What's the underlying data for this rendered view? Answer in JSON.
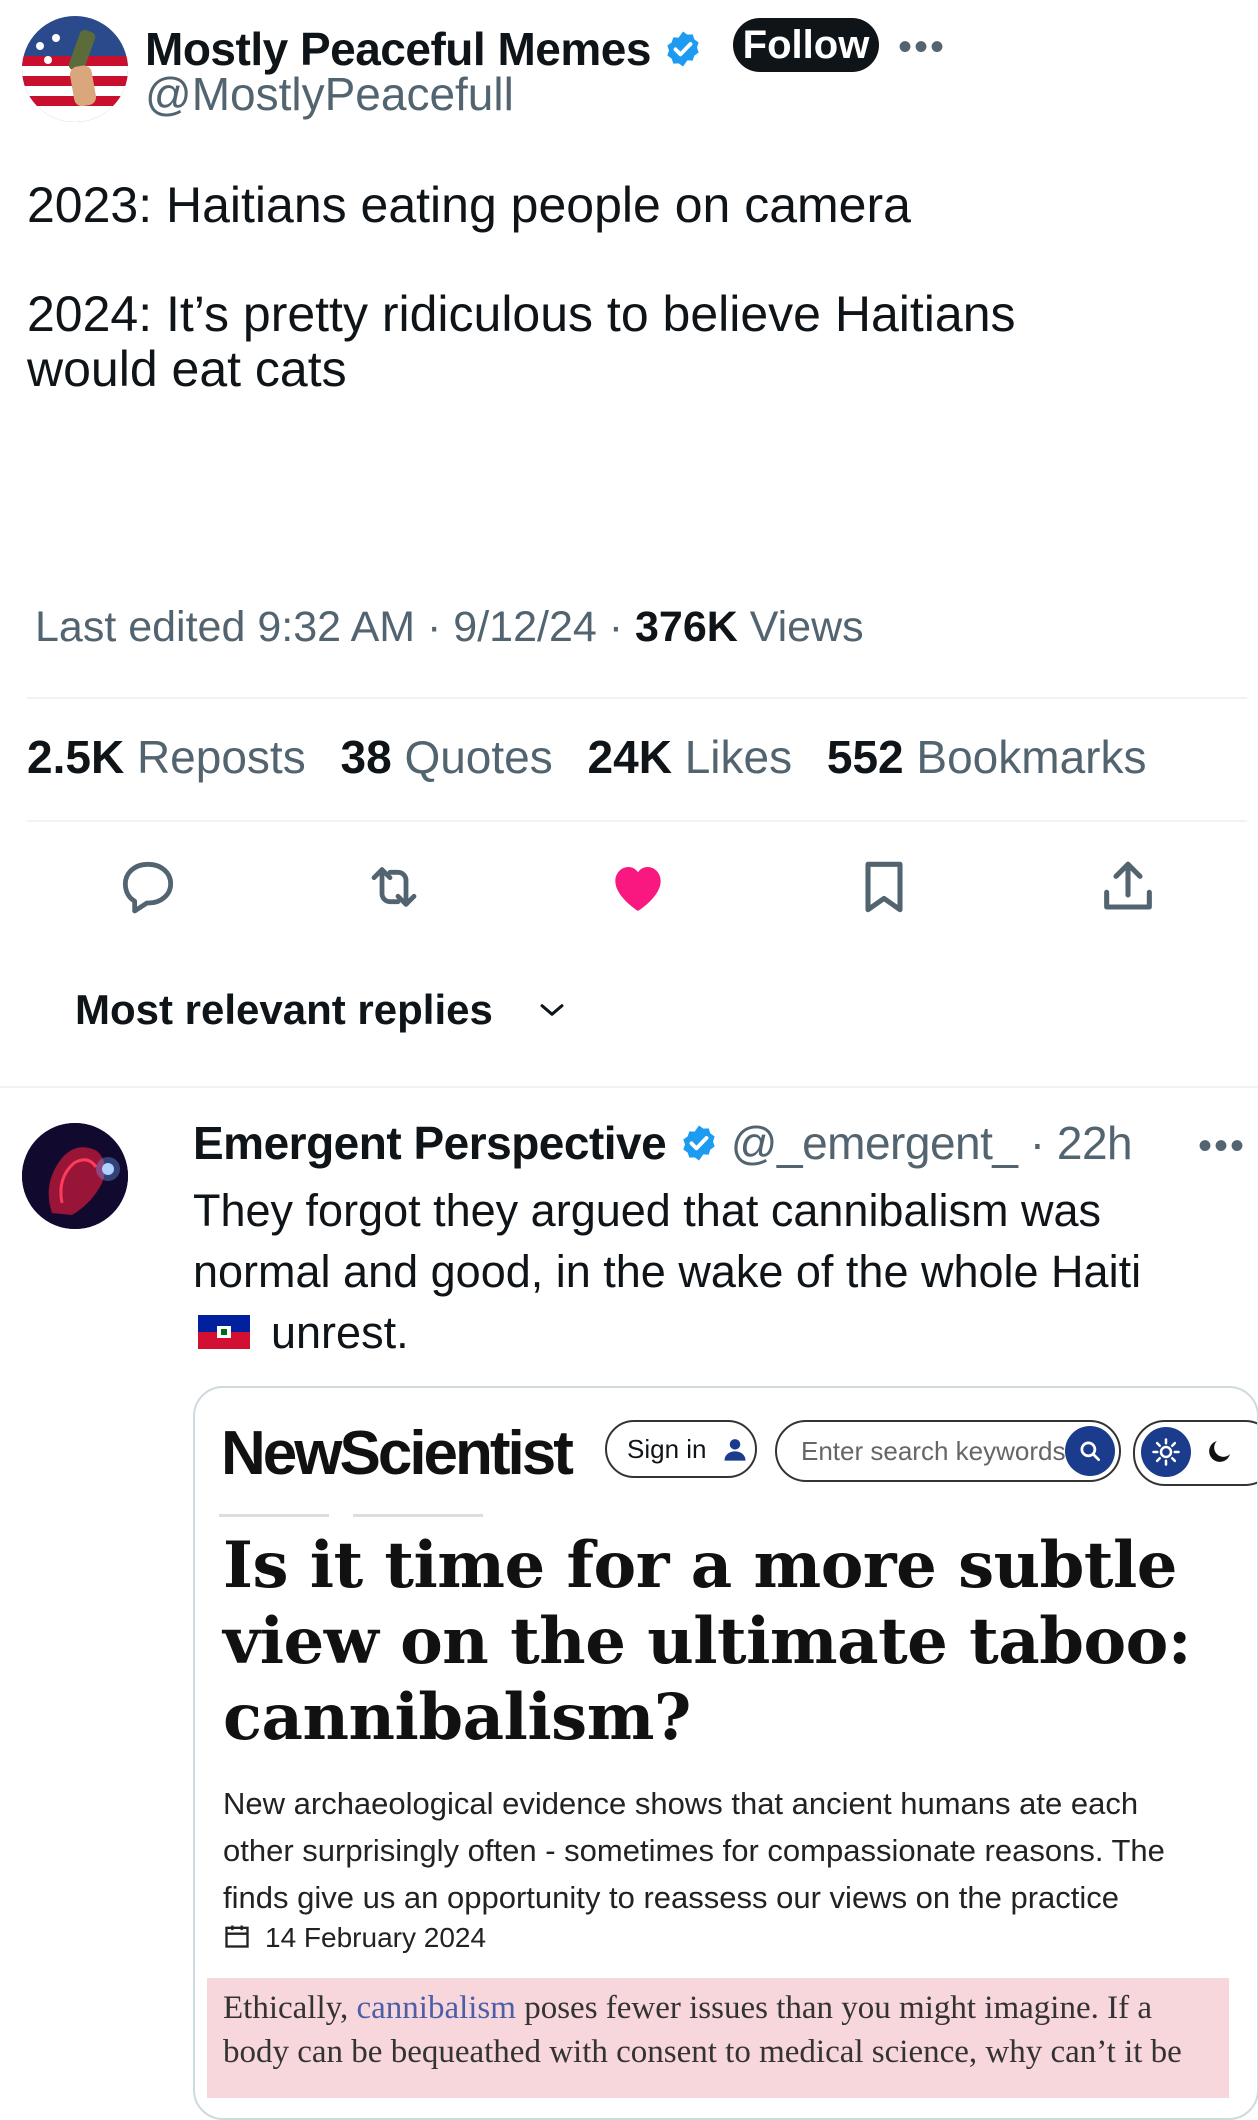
{
  "tweet": {
    "author_name": "Mostly Peaceful Memes",
    "author_handle": "@MostlyPeacefull",
    "follow_label": "Follow",
    "more_label": "•••",
    "text_line1": "2023: Haitians eating people on camera",
    "text_line2": "2024: It’s pretty ridiculous to believe Haitians",
    "text_line3": "would eat cats",
    "meta_edited": "Last edited 9:32 AM · 9/12/24 · ",
    "meta_views_count": "376K",
    "meta_views_label": " Views",
    "stats": {
      "reposts_count": "2.5K",
      "reposts_label": "Reposts",
      "quotes_count": "38",
      "quotes_label": "Quotes",
      "likes_count": "24K",
      "likes_label": "Likes",
      "bookmarks_count": "552",
      "bookmarks_label": "Bookmarks"
    },
    "actions": [
      "reply-icon",
      "repost-icon",
      "like-icon",
      "bookmark-icon",
      "share-icon"
    ],
    "like_color": "#f91880"
  },
  "replies_header": {
    "label": "Most relevant replies"
  },
  "reply": {
    "author_name": "Emergent Perspective",
    "handle_time": "@_emergent_ · 22h",
    "more_label": "•••",
    "text_line1": "They forgot they argued that cannibalism was",
    "text_line2": "normal and good, in the wake of the whole Haiti",
    "text_line3": "unrest.",
    "flag_icon": "haiti-flag"
  },
  "embed": {
    "logo": "NewScientist",
    "signin_label": "Sign in",
    "search_placeholder": "Enter search keywords",
    "headline_line1": "Is it time for a more subtle",
    "headline_line2": "view on the ultimate taboo:",
    "headline_line3": "cannibalism?",
    "subhead_line1": "New archaeological evidence shows that ancient humans ate each",
    "subhead_line2": "other surprisingly often - sometimes for compassionate reasons. The",
    "subhead_line3": "finds give us an opportunity to reassess our views on the practice",
    "date": "14 February 2024",
    "excerpt_pre": "Ethically, ",
    "excerpt_link": "cannibalism",
    "excerpt_post": " poses fewer issues than you might imagine. If a",
    "excerpt_line2": "body can be bequeathed with consent to medical science, why can’t it be"
  },
  "colors": {
    "verified": "#1d9bf0",
    "secondary_text": "#536471",
    "highlight": "#f7d6dc",
    "ns_blue": "#1b3c8c"
  }
}
